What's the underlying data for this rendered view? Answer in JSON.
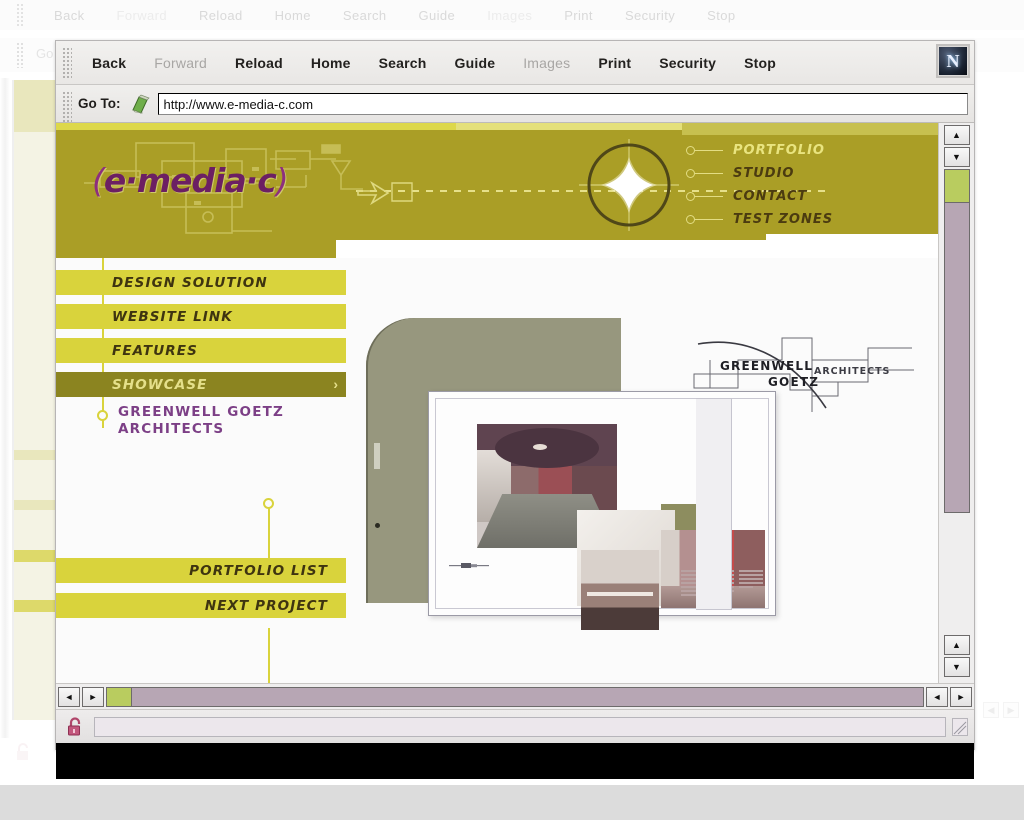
{
  "ghost_window": {
    "toolbar_buttons": [
      {
        "label": "Back",
        "enabled": true
      },
      {
        "label": "Forward",
        "enabled": false
      },
      {
        "label": "Reload",
        "enabled": true
      },
      {
        "label": "Home",
        "enabled": true
      },
      {
        "label": "Search",
        "enabled": true
      },
      {
        "label": "Guide",
        "enabled": true
      },
      {
        "label": "Images",
        "enabled": false
      },
      {
        "label": "Print",
        "enabled": true
      },
      {
        "label": "Security",
        "enabled": true
      },
      {
        "label": "Stop",
        "enabled": true
      }
    ],
    "goto_label": "Go To:"
  },
  "browser": {
    "toolbar": {
      "buttons": [
        {
          "label": "Back",
          "enabled": true
        },
        {
          "label": "Forward",
          "enabled": false
        },
        {
          "label": "Reload",
          "enabled": true
        },
        {
          "label": "Home",
          "enabled": true
        },
        {
          "label": "Search",
          "enabled": true
        },
        {
          "label": "Guide",
          "enabled": true
        },
        {
          "label": "Images",
          "enabled": false
        },
        {
          "label": "Print",
          "enabled": true
        },
        {
          "label": "Security",
          "enabled": true
        },
        {
          "label": "Stop",
          "enabled": true
        }
      ],
      "brand_glyph": "N"
    },
    "location": {
      "label": "Go To:",
      "url": "http://www.e-media-c.com",
      "placeholder": "http://"
    },
    "status": {
      "text": "",
      "lock_state": "unlocked"
    },
    "scrollbars": {
      "up_arrow": "▲",
      "down_arrow": "▼",
      "left_arrow": "◄",
      "right_arrow": "►"
    }
  },
  "site": {
    "logo": {
      "open_paren": "(",
      "text": "e·media·c",
      "close_paren": ")"
    },
    "top_nav": [
      {
        "label": "PORTFOLIO",
        "active": true
      },
      {
        "label": "STUDIO",
        "active": false
      },
      {
        "label": "CONTACT",
        "active": false
      },
      {
        "label": "TEST ZONES",
        "active": false
      }
    ],
    "side_nav": [
      {
        "label": "DESIGN SOLUTION",
        "active": false
      },
      {
        "label": "WEBSITE LINK",
        "active": false
      },
      {
        "label": "FEATURES",
        "active": false
      },
      {
        "label": "SHOWCASE",
        "active": true,
        "chevron": "›"
      }
    ],
    "project": {
      "line1": "GREENWELL GOETZ",
      "line2": "ARCHITECTS"
    },
    "side_nav_bottom": [
      {
        "label": "PORTFOLIO LIST"
      },
      {
        "label": "NEXT PROJECT"
      }
    ],
    "client_logo": {
      "line1": "GREENWELL",
      "line2": "GOETZ",
      "line3": "ARCHITECTS"
    }
  },
  "colors": {
    "header_olive": "#aa9e26",
    "accent_yellow": "#d9d33c",
    "active_olive": "#8b8420",
    "logo_purple": "#6c1f63",
    "project_purple": "#7c3f86",
    "scroll_thumb_green": "#b9cc5f",
    "scroll_track_mauve": "#b7a6b4",
    "slab_gray": "#97977e"
  }
}
